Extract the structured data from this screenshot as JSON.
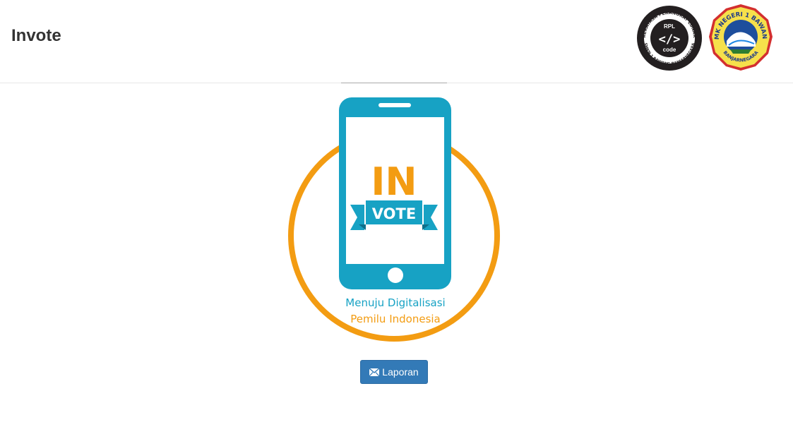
{
  "navbar": {
    "brand": "Invote",
    "logos": {
      "rpl": {
        "ring_text_top": "REKAYASA PERANGKAT LUNAK",
        "ring_text_bottom": "SMKN 1 BAWANG BANJARNEGARA",
        "center_top": "RPL",
        "center_symbol": "</>",
        "center_bottom": "code"
      },
      "smk": {
        "ring_text_top": "SMK NEGERI 1 BAWANG",
        "ring_text_bottom": "BANJARNEGARA"
      }
    }
  },
  "hero": {
    "logo_word_in": "IN",
    "logo_word_vote": "VOTE",
    "tagline_line1": "Menuju Digitalisasi",
    "tagline_line2": "Pemilu Indonesia",
    "colors": {
      "teal": "#17a2c4",
      "orange": "#f39c12"
    }
  },
  "actions": {
    "report_button_label": "Laporan",
    "report_button_icon": "envelope-icon",
    "button_color": "#337ab7"
  }
}
